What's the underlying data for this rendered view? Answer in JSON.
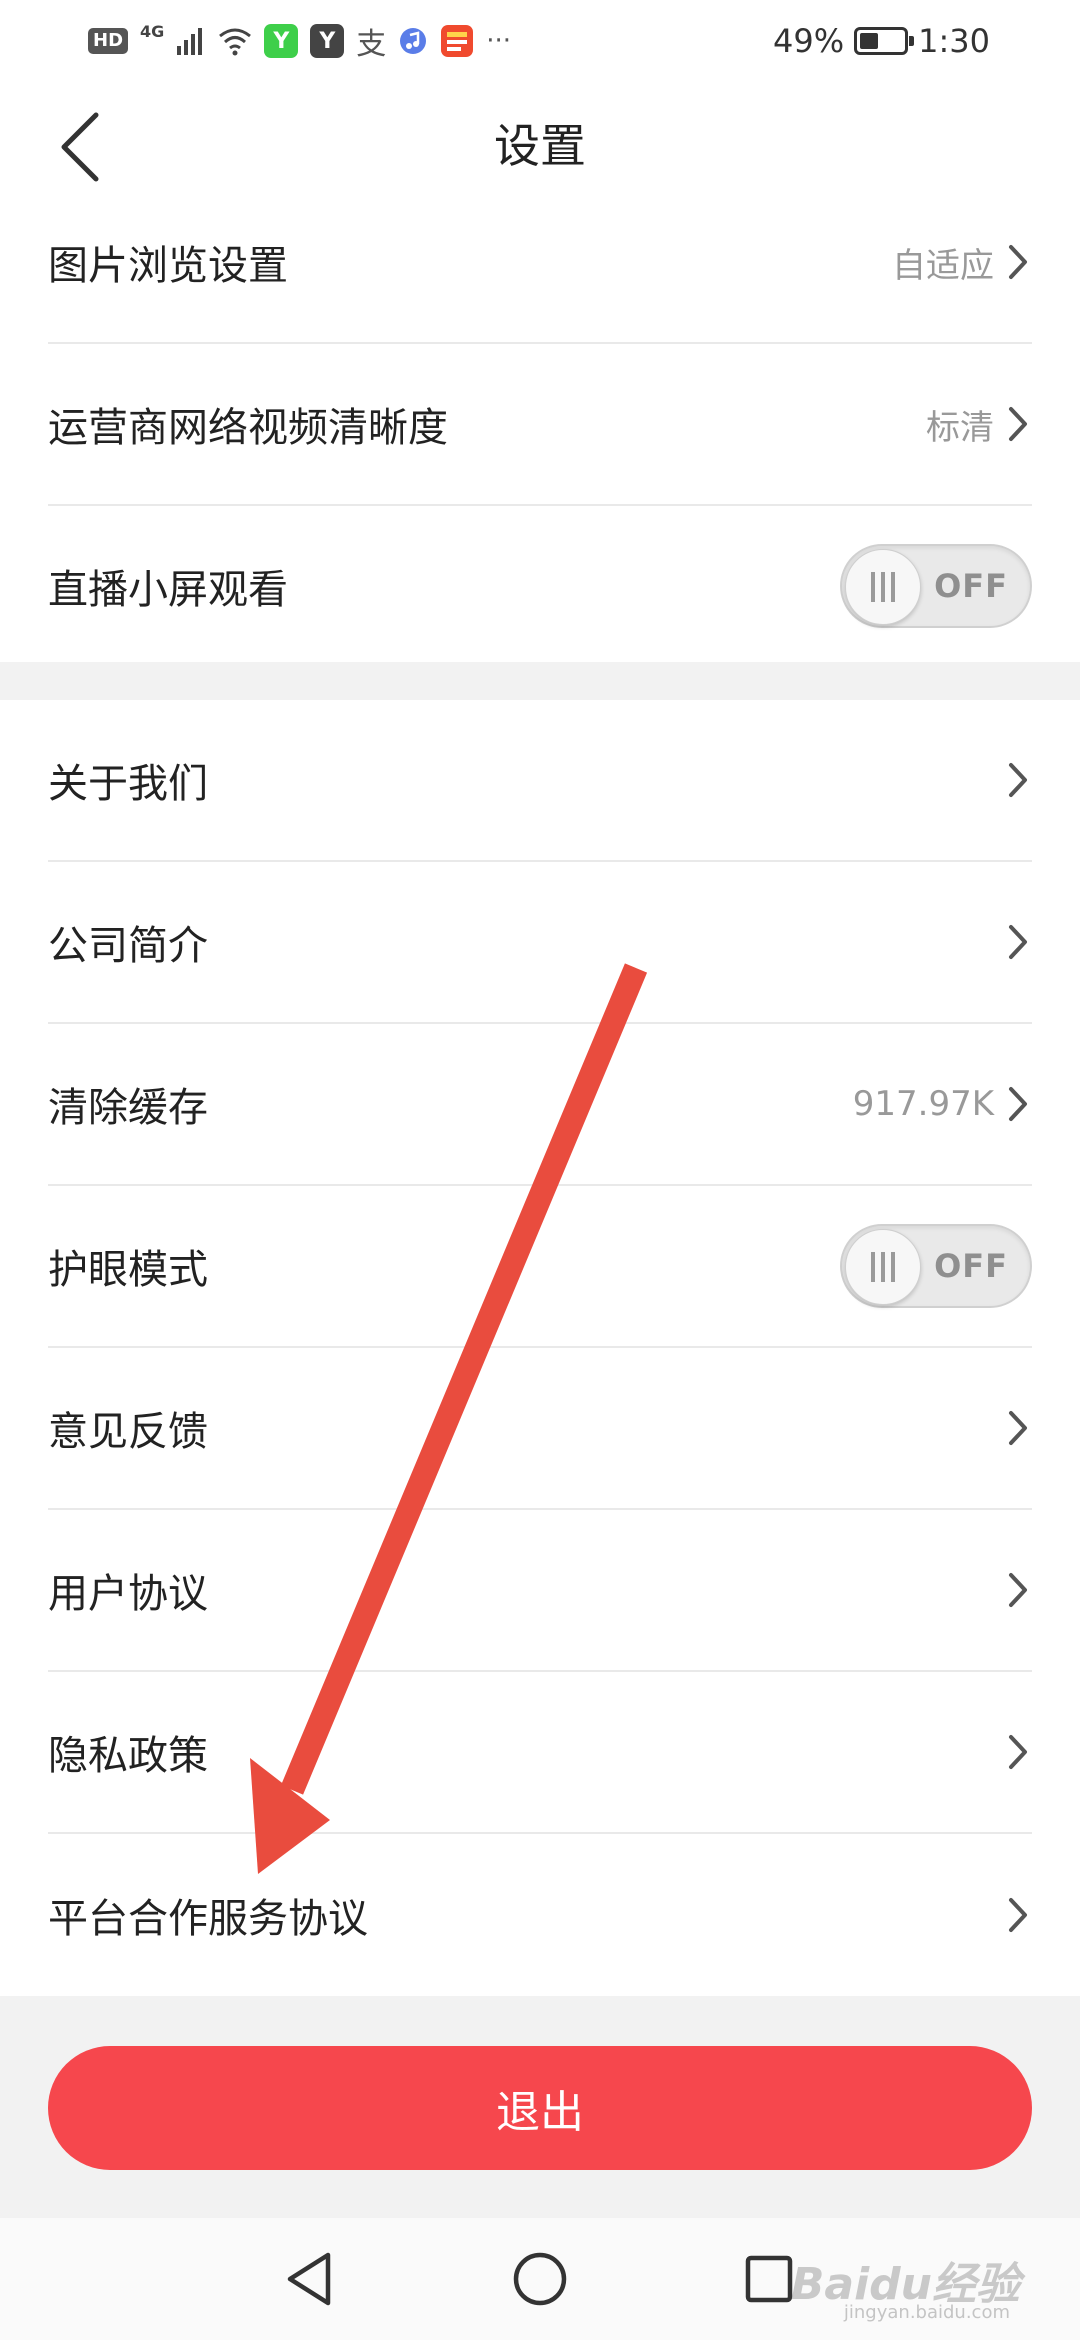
{
  "status_bar": {
    "hd": "HD",
    "network": "4G",
    "app_y1": "Y",
    "app_y2": "Y",
    "alipay": "支",
    "more": "···",
    "battery_text": "49%",
    "battery_level": 0.49,
    "time": "1:30"
  },
  "nav": {
    "title": "设置"
  },
  "group1": [
    {
      "label": "图片浏览设置",
      "value": "自适应"
    },
    {
      "label": "运营商网络视频清晰度",
      "value": "标清"
    },
    {
      "label": "直播小屏观看",
      "toggle": "OFF"
    }
  ],
  "group2": [
    {
      "label": "关于我们",
      "value": ""
    },
    {
      "label": "公司简介",
      "value": ""
    },
    {
      "label": "清除缓存",
      "value": "917.97K"
    },
    {
      "label": "护眼模式",
      "toggle": "OFF"
    },
    {
      "label": "意见反馈",
      "value": ""
    },
    {
      "label": "用户协议",
      "value": ""
    },
    {
      "label": "隐私政策",
      "value": ""
    },
    {
      "label": "平台合作服务协议",
      "value": ""
    }
  ],
  "logout": {
    "label": "退出"
  },
  "watermark": {
    "text": "Baidu经验",
    "sub": "jingyan.baidu.com"
  },
  "colors": {
    "accent": "#f6474d",
    "arrow": "#e94c3e"
  }
}
